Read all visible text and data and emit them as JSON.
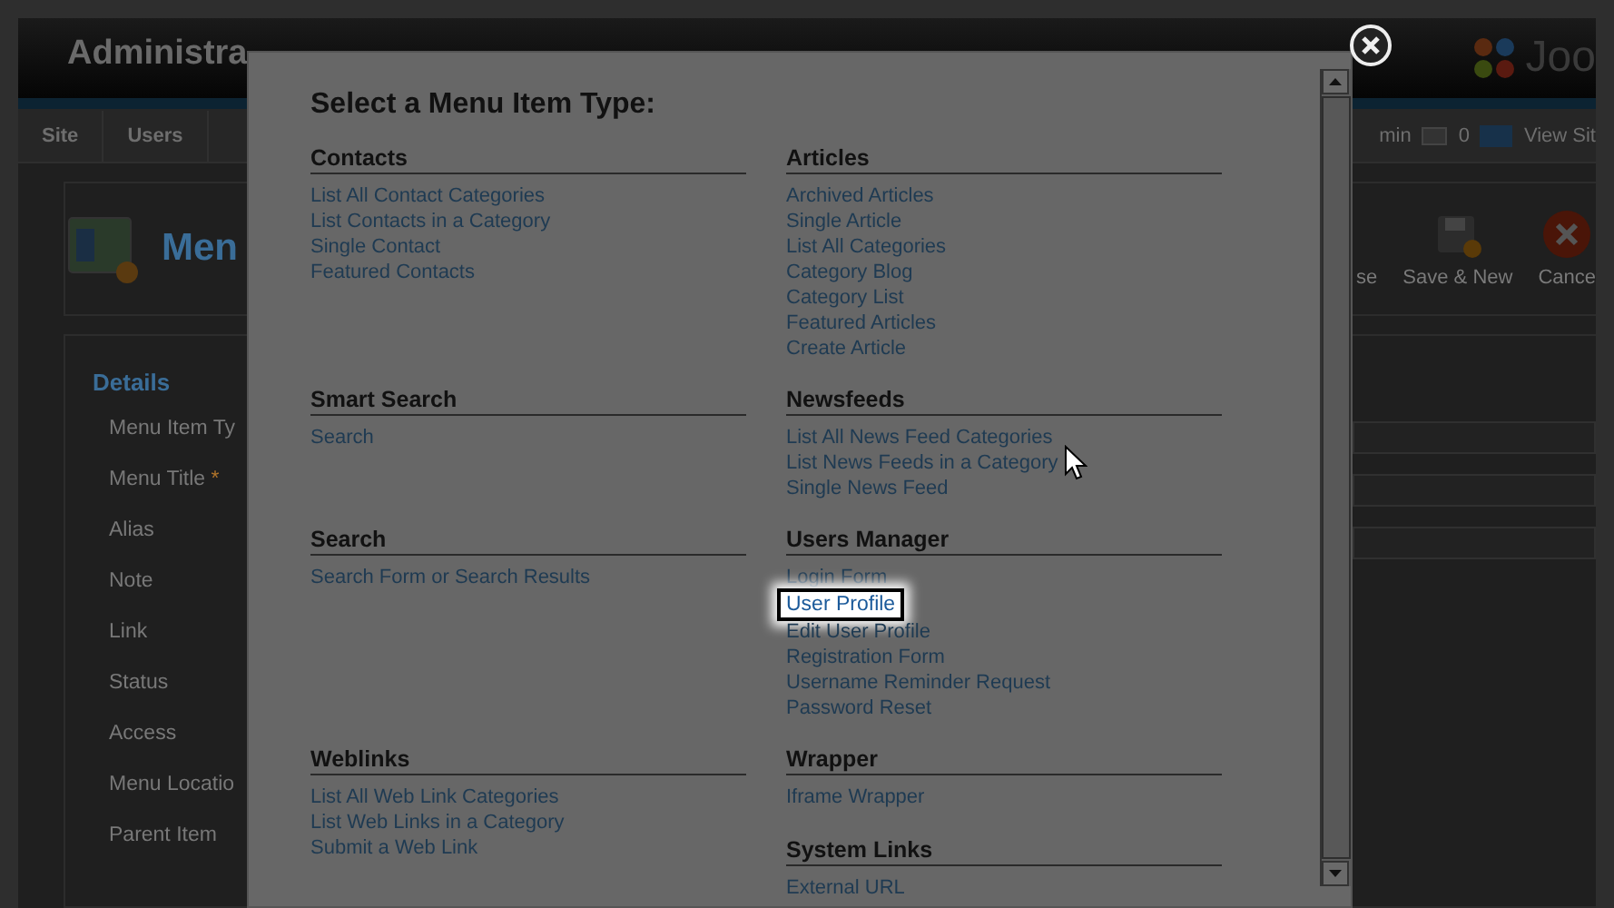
{
  "header": {
    "title": "Administra",
    "logo_text": "Joo"
  },
  "menu_bar": {
    "items": [
      "Site",
      "Users"
    ],
    "user": "min",
    "messages": "0",
    "view_site": "View Sit"
  },
  "toolbar": {
    "title": "Men",
    "buttons": [
      {
        "label": "se",
        "kind": "close"
      },
      {
        "label": "Save & New",
        "kind": "save-new"
      },
      {
        "label": "Cance",
        "kind": "cancel"
      }
    ]
  },
  "details": {
    "legend": "Details",
    "fields": [
      {
        "label": "Menu Item Ty",
        "has_input": true
      },
      {
        "label": "Menu Title",
        "marker": "*",
        "has_input": true
      },
      {
        "label": "Alias",
        "has_input": true
      },
      {
        "label": "Note",
        "has_input": false
      },
      {
        "label": "Link",
        "has_input": false
      },
      {
        "label": "Status",
        "has_input": false
      },
      {
        "label": "Access",
        "has_input": false
      },
      {
        "label": "Menu Locatio",
        "has_input": false
      },
      {
        "label": "Parent Item",
        "has_input": false
      }
    ]
  },
  "modal": {
    "title": "Select a Menu Item Type:",
    "section_rows": [
      {
        "left": {
          "heading": "Contacts",
          "items": [
            {
              "label": "List All Contact Categories",
              "highlighted": false
            },
            {
              "label": "List Contacts in a Category",
              "highlighted": false
            },
            {
              "label": "Single Contact",
              "highlighted": false
            },
            {
              "label": "Featured Contacts",
              "highlighted": false
            }
          ]
        },
        "right": {
          "heading": "Articles",
          "items": [
            {
              "label": "Archived Articles",
              "highlighted": false
            },
            {
              "label": "Single Article",
              "highlighted": false
            },
            {
              "label": "List All Categories",
              "highlighted": false
            },
            {
              "label": "Category Blog",
              "highlighted": false
            },
            {
              "label": "Category List",
              "highlighted": false
            },
            {
              "label": "Featured Articles",
              "highlighted": false
            },
            {
              "label": "Create Article",
              "highlighted": false
            }
          ]
        }
      },
      {
        "left": {
          "heading": "Smart Search",
          "items": [
            {
              "label": "Search",
              "highlighted": false
            }
          ]
        },
        "right": {
          "heading": "Newsfeeds",
          "items": [
            {
              "label": "List All News Feed Categories",
              "highlighted": false
            },
            {
              "label": "List News Feeds in a Category",
              "highlighted": false
            },
            {
              "label": "Single News Feed",
              "highlighted": false
            }
          ]
        }
      },
      {
        "left": {
          "heading": "Search",
          "items": [
            {
              "label": "Search Form or Search Results",
              "highlighted": false
            }
          ]
        },
        "right": {
          "heading": "Users Manager",
          "items": [
            {
              "label": "Login Form",
              "highlighted": false
            },
            {
              "label": "User Profile",
              "highlighted": true
            },
            {
              "label": "Edit User Profile",
              "highlighted": false
            },
            {
              "label": "Registration Form",
              "highlighted": false
            },
            {
              "label": "Username Reminder Request",
              "highlighted": false
            },
            {
              "label": "Password Reset",
              "highlighted": false
            }
          ]
        }
      },
      {
        "left": {
          "heading": "Weblinks",
          "items": [
            {
              "label": "List All Web Link Categories",
              "highlighted": false
            },
            {
              "label": "List Web Links in a Category",
              "highlighted": false
            },
            {
              "label": "Submit a Web Link",
              "highlighted": false
            }
          ]
        },
        "right": {
          "heading": "Wrapper",
          "items": [
            {
              "label": "Iframe Wrapper",
              "highlighted": false
            }
          ]
        }
      },
      {
        "right": {
          "heading": "System Links",
          "items": [
            {
              "label": "External URL",
              "highlighted": false
            }
          ]
        }
      }
    ]
  }
}
